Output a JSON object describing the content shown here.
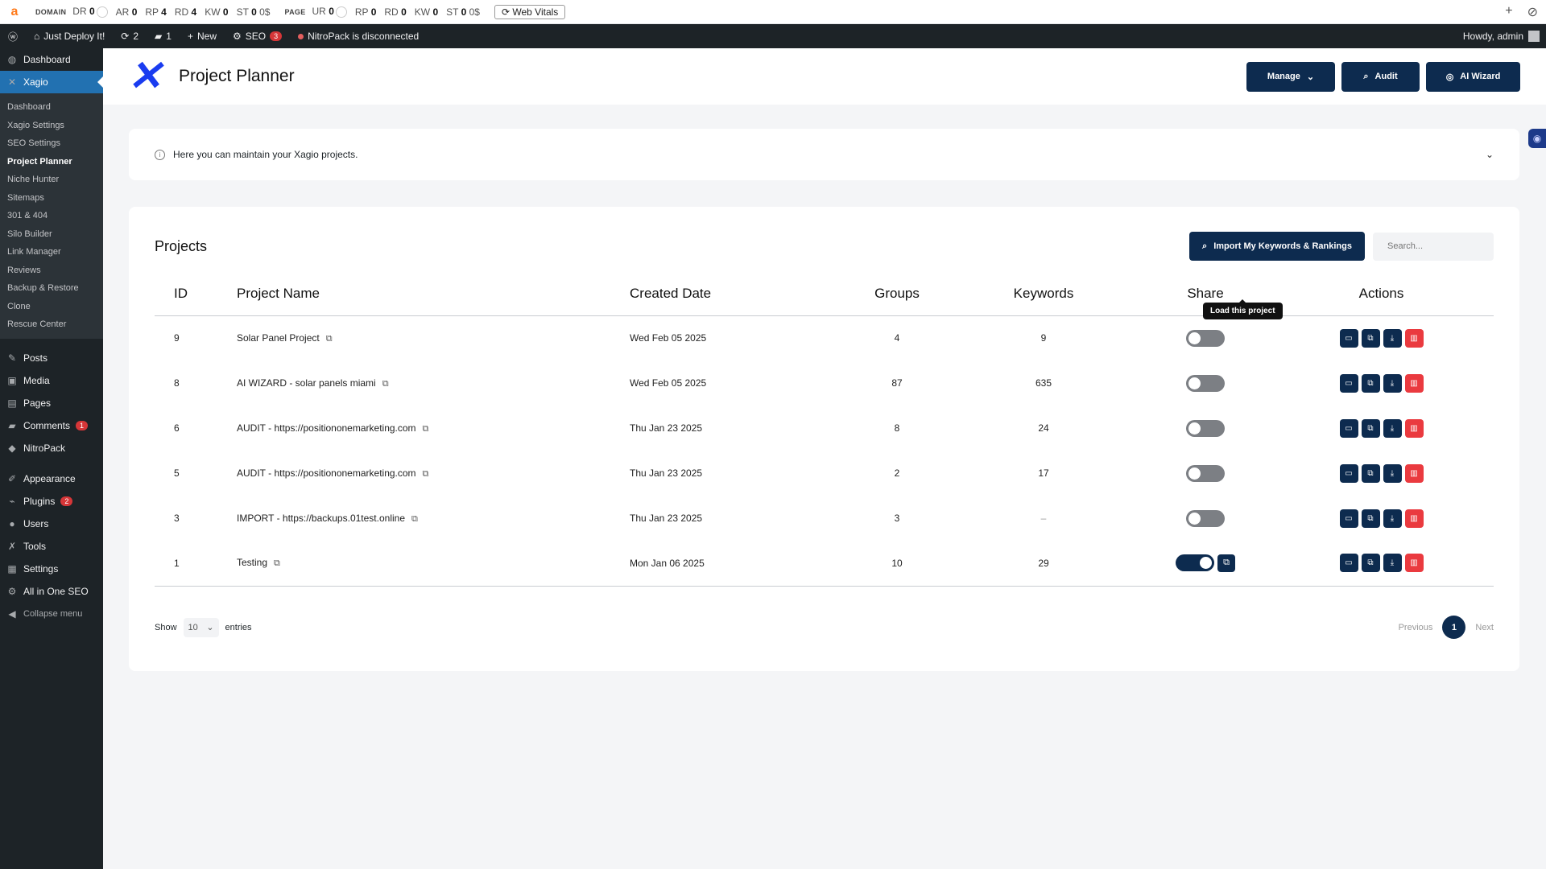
{
  "ahrefs": {
    "logo": "a",
    "domain_label": "DOMAIN",
    "page_label": "PAGE",
    "domain_metrics": [
      {
        "name": "DR",
        "value": "0"
      },
      {
        "name": "AR",
        "value": "0"
      },
      {
        "name": "RP",
        "value": "4"
      },
      {
        "name": "RD",
        "value": "4"
      },
      {
        "name": "KW",
        "value": "0"
      },
      {
        "name": "ST",
        "value": "0",
        "extra": "0$"
      }
    ],
    "page_metrics": [
      {
        "name": "UR",
        "value": "0"
      },
      {
        "name": "RP",
        "value": "0"
      },
      {
        "name": "RD",
        "value": "0"
      },
      {
        "name": "KW",
        "value": "0"
      },
      {
        "name": "ST",
        "value": "0",
        "extra": "0$"
      }
    ],
    "web_vitals": "Web Vitals"
  },
  "adminbar": {
    "site_name": "Just Deploy It!",
    "updates": "2",
    "comments": "1",
    "new_label": "New",
    "seo_label": "SEO",
    "seo_badge": "3",
    "nitropack_status": "NitroPack is disconnected",
    "howdy": "Howdy, admin"
  },
  "sidebar": {
    "dashboard": "Dashboard",
    "xagio": "Xagio",
    "submenu": [
      "Dashboard",
      "Xagio Settings",
      "SEO Settings",
      "Project Planner",
      "Niche Hunter",
      "Sitemaps",
      "301 & 404",
      "Silo Builder",
      "Link Manager",
      "Reviews",
      "Backup & Restore",
      "Clone",
      "Rescue Center"
    ],
    "posts": "Posts",
    "media": "Media",
    "pages": "Pages",
    "comments": "Comments",
    "comments_badge": "1",
    "nitropack": "NitroPack",
    "appearance": "Appearance",
    "plugins": "Plugins",
    "plugins_badge": "2",
    "users": "Users",
    "tools": "Tools",
    "settings": "Settings",
    "aioseo": "All in One SEO",
    "collapse": "Collapse menu"
  },
  "header": {
    "title": "Project Planner",
    "manage_btn": "Manage",
    "audit_btn": "Audit",
    "ai_wizard_btn": "AI Wizard"
  },
  "info": {
    "text": "Here you can maintain your Xagio projects."
  },
  "projects": {
    "title": "Projects",
    "import_btn": "Import My Keywords & Rankings",
    "search_placeholder": "Search...",
    "columns": [
      "ID",
      "Project Name",
      "Created Date",
      "Groups",
      "Keywords",
      "Share",
      "Actions"
    ],
    "rows": [
      {
        "id": "9",
        "name": "Solar Panel Project",
        "date": "Wed Feb 05 2025",
        "groups": "4",
        "keywords": "9",
        "shared": false
      },
      {
        "id": "8",
        "name": "AI WIZARD - solar panels miami",
        "date": "Wed Feb 05 2025",
        "groups": "87",
        "keywords": "635",
        "shared": false
      },
      {
        "id": "6",
        "name": "AUDIT - https://positiononemarketing.com",
        "date": "Thu Jan 23 2025",
        "groups": "8",
        "keywords": "24",
        "shared": false
      },
      {
        "id": "5",
        "name": "AUDIT - https://positiononemarketing.com",
        "date": "Thu Jan 23 2025",
        "groups": "2",
        "keywords": "17",
        "shared": false
      },
      {
        "id": "3",
        "name": "IMPORT - https://backups.01test.online",
        "date": "Thu Jan 23 2025",
        "groups": "3",
        "keywords": "–",
        "shared": false
      },
      {
        "id": "1",
        "name": "Testing",
        "date": "Mon Jan 06 2025",
        "groups": "10",
        "keywords": "29",
        "shared": true
      }
    ],
    "tooltip": "Load this project",
    "show_label": "Show",
    "page_size": "10",
    "entries_label": "entries",
    "prev": "Previous",
    "page": "1",
    "next": "Next"
  },
  "colors": {
    "primary": "#0d2b4f",
    "danger": "#ea3a3f",
    "wp_dark": "#1d2327",
    "wp_blue": "#2271b1",
    "logo_blue": "#1a3cf0"
  }
}
